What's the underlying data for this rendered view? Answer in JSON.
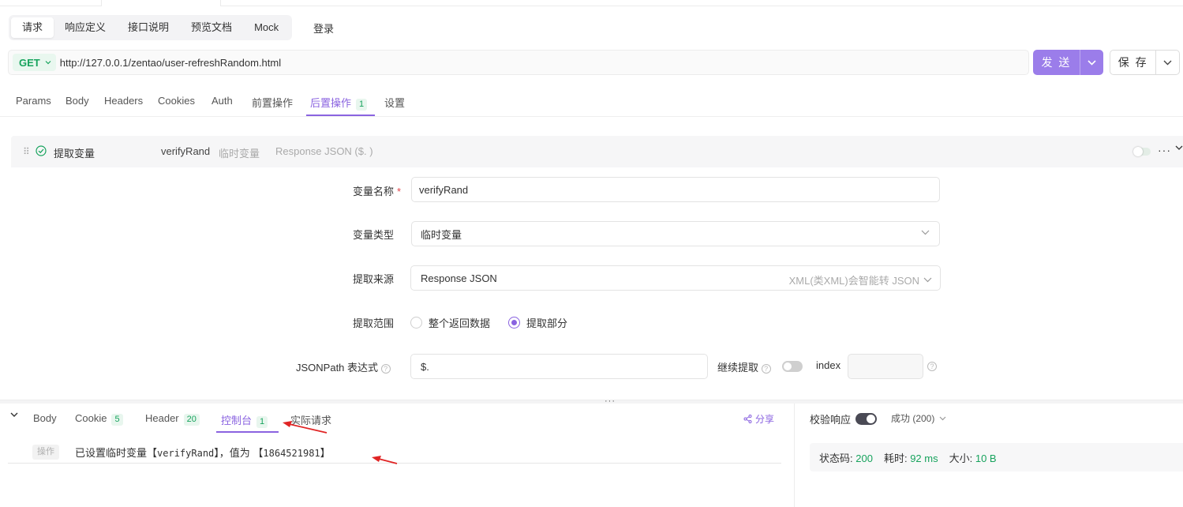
{
  "mode_tabs": [
    "请求",
    "响应定义",
    "接口说明",
    "预览文档",
    "Mock"
  ],
  "login_label": "登录",
  "request": {
    "method": "GET",
    "url": "http://127.0.0.1/zentao/user-refreshRandom.html",
    "send_label": "发 送",
    "save_label": "保 存"
  },
  "request_tabs": [
    {
      "label": "Params"
    },
    {
      "label": "Body"
    },
    {
      "label": "Headers"
    },
    {
      "label": "Cookies"
    },
    {
      "label": "Auth"
    },
    {
      "label": "前置操作"
    },
    {
      "label": "后置操作",
      "badge": "1",
      "active": true
    },
    {
      "label": "设置"
    }
  ],
  "post_op": {
    "title": "提取变量",
    "var_name": "verifyRand",
    "var_type": "临时变量",
    "source": "Response JSON ($. )",
    "more": "···"
  },
  "form": {
    "name_label": "变量名称",
    "required_mark": "*",
    "name_value": "verifyRand",
    "type_label": "变量类型",
    "type_value": "临时变量",
    "source_label": "提取来源",
    "source_value": "Response JSON",
    "source_hint": "XML(类XML)会智能转 JSON",
    "scope_label": "提取范围",
    "scope_option_all": "整个返回数据",
    "scope_option_part": "提取部分",
    "jsonpath_label": "JSONPath 表达式",
    "jsonpath_value": "$.",
    "continue_label": "继续提取",
    "index_label": "index",
    "index_value": ""
  },
  "response_tabs": [
    {
      "label": "Body"
    },
    {
      "label": "Cookie",
      "badge": "5"
    },
    {
      "label": "Header",
      "badge": "20"
    },
    {
      "label": "控制台",
      "badge": "1",
      "active": true
    },
    {
      "label": "实际请求"
    }
  ],
  "share_label": "分享",
  "console": {
    "op_tag": "操作",
    "msg_prefix": "已设置临时变量【",
    "msg_var": "verifyRand",
    "msg_mid": "】，值为 【",
    "msg_value": "1864521981",
    "msg_suffix": "】"
  },
  "verify": {
    "label": "校验响应",
    "status_option": "成功 (200)"
  },
  "stats": {
    "status_label": "状态码:",
    "status_value": "200",
    "time_label": "耗时:",
    "time_value": "92 ms",
    "size_label": "大小:",
    "size_value": "10 B"
  },
  "colors": {
    "accent": "#8a63e0",
    "send_button": "#9b7dea",
    "success": "#17a35d",
    "annotation": "#e02424"
  }
}
